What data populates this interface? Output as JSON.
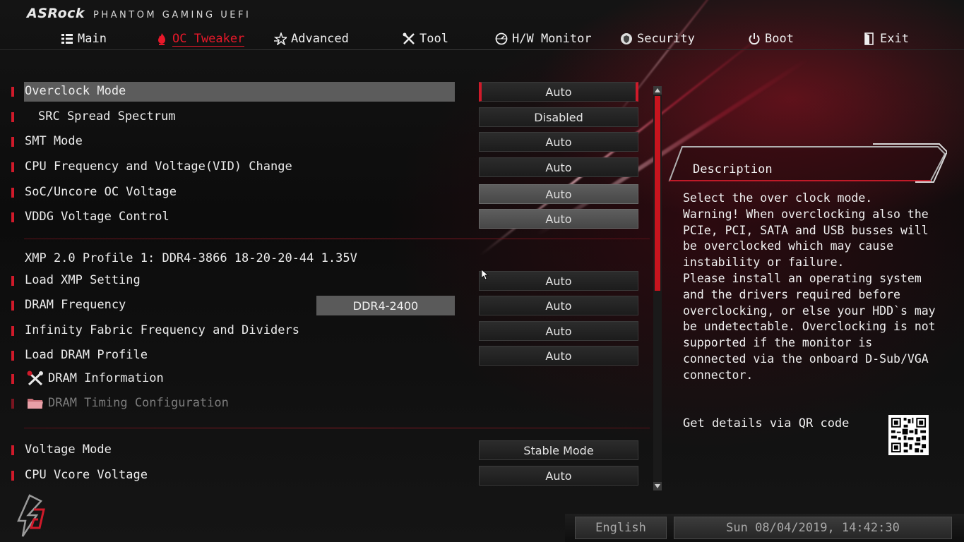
{
  "header": {
    "brand": "ASRock",
    "subtitle": "PHANTOM GAMING UEFI"
  },
  "nav": {
    "tabs": [
      {
        "label": "Main",
        "icon": "main-icon",
        "active": false
      },
      {
        "label": "OC Tweaker",
        "icon": "oc-tweaker-icon",
        "active": true
      },
      {
        "label": "Advanced",
        "icon": "advanced-icon",
        "active": false
      },
      {
        "label": "Tool",
        "icon": "tool-icon",
        "active": false
      },
      {
        "label": "H/W Monitor",
        "icon": "hw-monitor-icon",
        "active": false
      },
      {
        "label": "Security",
        "icon": "security-icon",
        "active": false
      },
      {
        "label": "Boot",
        "icon": "power-icon",
        "active": false
      },
      {
        "label": "Exit",
        "icon": "exit-icon",
        "active": false
      }
    ]
  },
  "settings": {
    "overclock_mode": {
      "label": "Overclock Mode",
      "value": "Auto"
    },
    "src_spread": {
      "label": "SRC Spread Spectrum",
      "value": "Disabled"
    },
    "smt_mode": {
      "label": "SMT Mode",
      "value": "Auto"
    },
    "cpu_freq_vid": {
      "label": "CPU Frequency and Voltage(VID) Change",
      "value": "Auto"
    },
    "soc_uncore": {
      "label": "SoC/Uncore OC Voltage",
      "value": "Auto"
    },
    "vddg": {
      "label": "VDDG Voltage Control",
      "value": "Auto"
    },
    "xmp_profile": "XMP 2.0 Profile 1: DDR4-3866 18-20-20-44 1.35V",
    "load_xmp": {
      "label": "Load XMP Setting",
      "value": "Auto"
    },
    "dram_freq": {
      "label": "DRAM Frequency",
      "current": "DDR4-2400",
      "value": "Auto"
    },
    "infinity_fabric": {
      "label": "Infinity Fabric Frequency and Dividers",
      "value": "Auto"
    },
    "load_dram_profile": {
      "label": "Load DRAM Profile",
      "value": "Auto"
    },
    "dram_info": {
      "label": "DRAM Information"
    },
    "dram_timing": {
      "label": "DRAM Timing Configuration"
    },
    "voltage_mode": {
      "label": "Voltage Mode",
      "value": "Stable Mode"
    },
    "cpu_vcore": {
      "label": "CPU Vcore Voltage",
      "value": "Auto"
    }
  },
  "description": {
    "title": "Description",
    "lines": [
      "Select the over clock mode.",
      "Warning! When overclocking also the",
      "PCIe, PCI, SATA and USB busses will",
      "be overclocked which may cause",
      "instability or failure.",
      "Please install an operating system",
      "and the drivers required before",
      "overclocking, or else your HDD`s may",
      "be undetectable. Overclocking is not",
      "supported if the monitor is",
      "connected via the onboard D-Sub/VGA",
      "connector."
    ],
    "qr_text": "Get details via QR code"
  },
  "footer": {
    "language": "English",
    "datetime": "Sun 08/04/2019, 14:42:30"
  },
  "colors": {
    "accent": "#d01a2a",
    "background": "#0a0a0a",
    "selected_row": "#5c5c5c"
  }
}
